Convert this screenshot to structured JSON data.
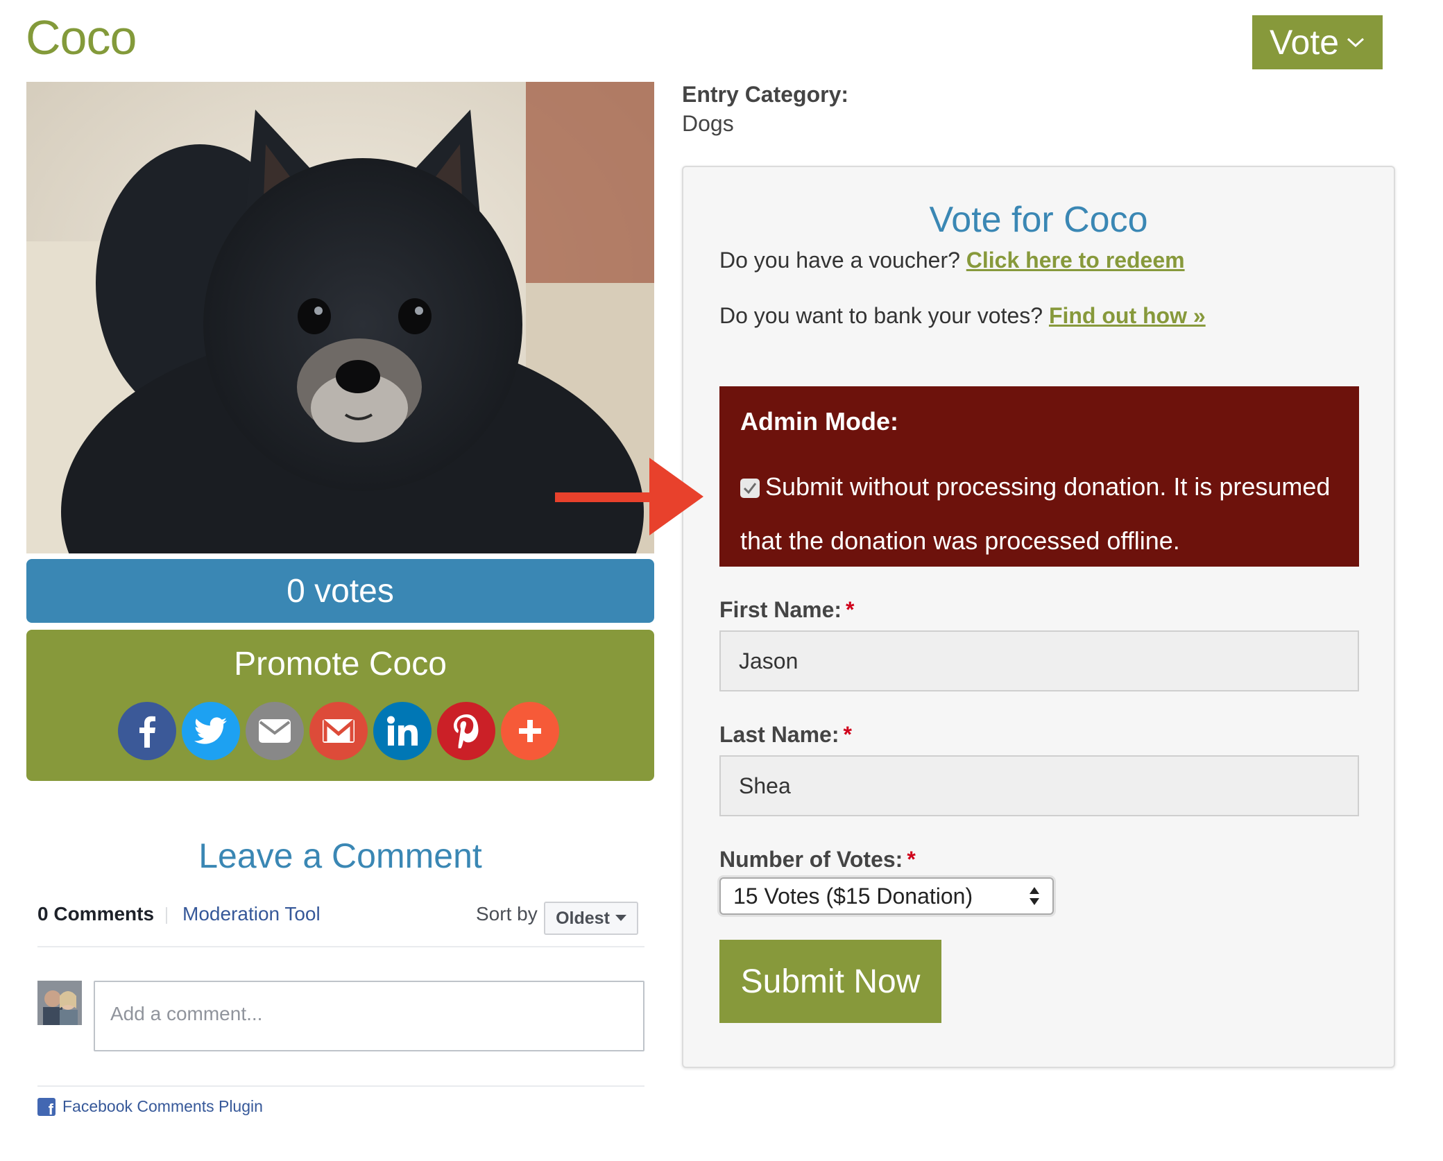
{
  "entry": {
    "title": "Coco"
  },
  "header": {
    "vote_button": "Vote"
  },
  "left": {
    "votes_label": "0 votes",
    "promote_title": "Promote Coco",
    "share_buttons": [
      {
        "name": "facebook-icon",
        "color": "#3b5998"
      },
      {
        "name": "twitter-icon",
        "color": "#1da1f2"
      },
      {
        "name": "email-icon",
        "color": "#888888"
      },
      {
        "name": "gmail-icon",
        "color": "#dd4b39"
      },
      {
        "name": "linkedin-icon",
        "color": "#0077b5"
      },
      {
        "name": "pinterest-icon",
        "color": "#cb2027"
      },
      {
        "name": "more-share-icon",
        "color": "#f65a38"
      }
    ]
  },
  "comments": {
    "heading": "Leave a Comment",
    "count": "0 Comments",
    "moderation": "Moderation Tool",
    "sort_by": "Sort by",
    "sort_value": "Oldest",
    "placeholder": "Add a comment...",
    "plugin": "Facebook Comments Plugin"
  },
  "entry_category": {
    "label": "Entry Category:",
    "value": "Dogs"
  },
  "vote_panel": {
    "title": "Vote for Coco",
    "voucher_text": "Do you have a voucher?",
    "voucher_link": "Click here to redeem",
    "bank_text": "Do you want to bank your votes?",
    "bank_link": "Find out how »",
    "admin": {
      "heading": "Admin Mode:",
      "text": "Submit without processing donation. It is presumed that the donation was processed offline.",
      "checked": true
    },
    "first_name": {
      "label": "First Name:",
      "value": "Jason"
    },
    "last_name": {
      "label": "Last Name:",
      "value": "Shea"
    },
    "required_mark": "*",
    "votes": {
      "label": "Number of Votes:",
      "selected": "15 Votes ($15 Donation)"
    },
    "submit": "Submit Now"
  },
  "colors": {
    "brand_green": "#87993b",
    "brand_blue": "#3a87b4",
    "admin_red": "#6d120c",
    "annotation_arrow": "#e8412c"
  }
}
